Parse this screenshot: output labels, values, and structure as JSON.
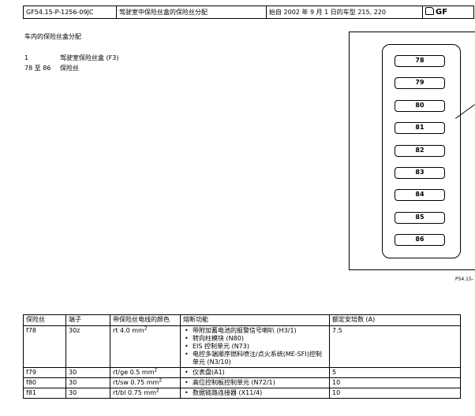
{
  "header": {
    "doc_id": "GF54.15-P-1256-09JC",
    "doc_title": "驾驶室中保险丝盒的保险丝分配",
    "doc_scope": "始自 2002 年 9 月 1 日的车型 215, 220",
    "doc_badge": "GF"
  },
  "section_title": "车内的保险丝盒分配",
  "legend": [
    {
      "num": "1",
      "text": "驾驶室保险丝盒 (F3)"
    },
    {
      "num": "78 至 86",
      "text": "保险丝"
    }
  ],
  "figure": {
    "fuses": [
      "78",
      "79",
      "80",
      "81",
      "82",
      "83",
      "84",
      "85",
      "86"
    ],
    "figure_id": "P54.15-"
  },
  "table": {
    "headers": [
      "保险丝",
      "端子",
      "带保险丝电线的颜色",
      "熔断功能",
      "额定安培数 (A)"
    ],
    "rows": [
      {
        "fuse": "f78",
        "terminal": "30z",
        "wire": "rt 4.0 mm",
        "wire_sup": "2",
        "functions": [
          "带附加蓄电池的报警信号喇叭 (H3/1)",
          "转向柱模块 (N80)",
          "EIS 控制单元 (N73)",
          "电控多端顺序燃料喷注/点火系统(ME-SFI)控制单元 (N3/10)"
        ],
        "amps": "7.5"
      },
      {
        "fuse": "f79",
        "terminal": "30",
        "wire": "rt/ge 0.5 mm",
        "wire_sup": "2",
        "functions": [
          "仪表盘(A1)"
        ],
        "amps": "5"
      },
      {
        "fuse": "f80",
        "terminal": "30",
        "wire": "rt/sw 0.75 mm",
        "wire_sup": "2",
        "functions": [
          "高位控制板控制单元 (N72/1)"
        ],
        "amps": "10"
      },
      {
        "fuse": "f81",
        "terminal": "30",
        "wire": "rt/bl 0.75 mm",
        "wire_sup": "2",
        "functions": [
          "数据链路连接器 (X11/4)"
        ],
        "amps": "10"
      }
    ]
  }
}
